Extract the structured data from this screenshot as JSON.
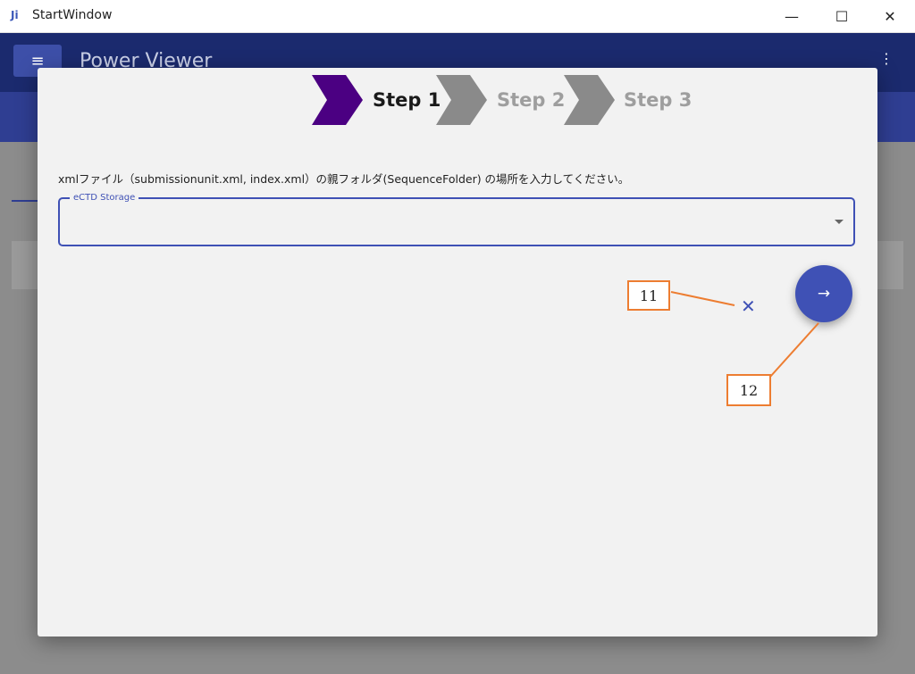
{
  "window": {
    "title": "StartWindow",
    "app_icon": "Ji",
    "minimize": "—",
    "maximize": "☐",
    "close": "✕"
  },
  "app": {
    "title": "Power Viewer",
    "menu_icon": "≡",
    "more_icon": "⋮"
  },
  "steps": [
    {
      "label": "Step 1",
      "state": "active",
      "color": "#4b0082",
      "text_color": "#1a1a1a"
    },
    {
      "label": "Step 2",
      "state": "inactive",
      "color": "#8a8a8a",
      "text_color": "#9e9e9e"
    },
    {
      "label": "Step 3",
      "state": "inactive",
      "color": "#8a8a8a",
      "text_color": "#9e9e9e"
    }
  ],
  "dialog": {
    "instruction": "xmlファイル（submissionunit.xml, index.xml）の親フォルダ(SequenceFolder) の場所を入力してください。",
    "field_label": "eCTD Storage",
    "field_value": "",
    "cancel_icon": "✕",
    "next_icon": "→"
  },
  "callouts": [
    {
      "label": "11"
    },
    {
      "label": "12"
    }
  ],
  "colors": {
    "accent": "#3f51b5",
    "callout": "#ed7d31",
    "appbar": "#1b2a6e"
  }
}
